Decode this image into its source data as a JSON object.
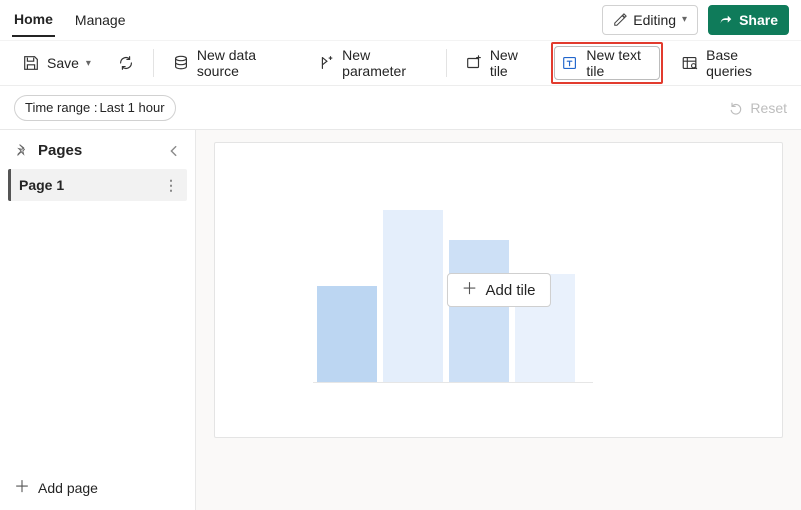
{
  "tabs": {
    "home": "Home",
    "manage": "Manage"
  },
  "topright": {
    "editing": "Editing",
    "share": "Share"
  },
  "toolbar": {
    "save": "Save",
    "new_data_source": "New data source",
    "new_parameter": "New parameter",
    "new_tile": "New tile",
    "new_text_tile": "New text tile",
    "base_queries": "Base queries"
  },
  "timerange": {
    "label_prefix": "Time range : ",
    "value": "Last 1 hour"
  },
  "reset": "Reset",
  "sidebar": {
    "header": "Pages",
    "items": [
      {
        "label": "Page 1"
      }
    ],
    "add_page": "Add page"
  },
  "canvas": {
    "add_tile": "Add tile"
  },
  "icons": {
    "pencil": "pencil-icon",
    "share": "share-icon",
    "save": "save-icon",
    "refresh": "refresh-icon",
    "db": "database-icon",
    "param": "parameter-icon",
    "tile": "tile-icon",
    "text_tile": "text-tile-icon",
    "base_queries": "base-queries-icon",
    "pin": "pin-icon",
    "chevron_left": "chevron-left-icon",
    "more": "more-icon",
    "plus": "plus-icon",
    "undo": "undo-icon",
    "chevron_down": "chevron-down-icon"
  }
}
